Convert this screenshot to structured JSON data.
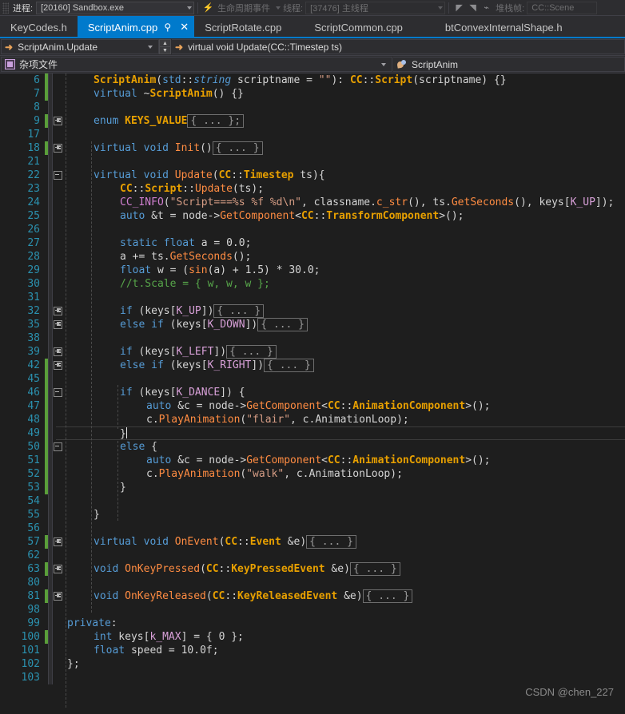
{
  "debug_toolbar": {
    "process_label": "进程:",
    "process_value": "[20160] Sandbox.exe",
    "lifecycle_label": "生命周期事件",
    "thread_label": "线程:",
    "thread_value": "[37476] 主线程",
    "stackframe_label": "堆栈帧:",
    "stackframe_value": "CC::Scene",
    "icons": [
      "grip-icon",
      "chevron-down-icon",
      "step-back-icon",
      "step-forward-icon",
      "diagram-icon"
    ]
  },
  "tabs": [
    {
      "label": "KeyCodes.h",
      "active": false
    },
    {
      "label": "ScriptAnim.cpp",
      "active": true,
      "pin": "pin-icon",
      "close": "close-icon"
    },
    {
      "label": "ScriptRotate.cpp",
      "active": false
    },
    {
      "label": "ScriptCommon.cpp",
      "active": false
    },
    {
      "label": "btConvexInternalShape.h",
      "active": false
    }
  ],
  "navbar": {
    "scope": "ScriptAnim.Update",
    "member": "virtual void Update(CC::Timestep ts)",
    "scope_icon": "arrow-right-icon",
    "member_icon": "arrow-right-icon",
    "spinner_up": "▲",
    "spinner_down": "▼"
  },
  "projectbar": {
    "project": "杂项文件",
    "project_icon": "misc-file-icon",
    "class": "ScriptAnim",
    "class_icon": "class-icon"
  },
  "editor": {
    "language": "cpp",
    "current_line": 49,
    "lines": [
      {
        "num": 6,
        "indent": 1,
        "change": "saved",
        "fold": "none",
        "html": "<span class=\"type\">ScriptAnim</span><span class=\"plain\">(</span><span class=\"kw\">std</span><span class=\"plain\">::</span><span class=\"ital\">string</span><span class=\"plain\"> scriptname = </span><span class=\"str\">\"\"</span><span class=\"plain\">): </span><span class=\"type\">CC</span><span class=\"plain\">::</span><span class=\"type\">Script</span><span class=\"plain\">(scriptname) {}</span>"
      },
      {
        "num": 7,
        "indent": 1,
        "change": "saved",
        "fold": "none",
        "html": "<span class=\"kw\">virtual</span><span class=\"plain\"> ~</span><span class=\"type\">ScriptAnim</span><span class=\"plain\">() {}</span>"
      },
      {
        "num": 8,
        "indent": 1,
        "change": "none",
        "fold": "none",
        "html": ""
      },
      {
        "num": 9,
        "indent": 1,
        "change": "saved",
        "fold": "plus",
        "html": "<span class=\"kw\">enum</span><span class=\"plain\"> </span><span class=\"type\">KEYS_VALUE</span><span class=\"collapsed\">{ ... };</span>"
      },
      {
        "num": 17,
        "indent": 1,
        "change": "none",
        "fold": "none",
        "html": ""
      },
      {
        "num": 18,
        "indent": 1,
        "change": "saved",
        "fold": "plus",
        "html": "<span class=\"kw\">virtual</span><span class=\"plain\"> </span><span class=\"kw\">void</span><span class=\"plain\"> </span><span class=\"fn\">Init</span><span class=\"plain\">()</span><span class=\"collapsed\">{ ... }</span>"
      },
      {
        "num": 21,
        "indent": 1,
        "change": "none",
        "fold": "none",
        "html": ""
      },
      {
        "num": 22,
        "indent": 1,
        "change": "none",
        "fold": "box",
        "html": "<span class=\"kw\">virtual</span><span class=\"plain\"> </span><span class=\"kw\">void</span><span class=\"plain\"> </span><span class=\"fn\">Update</span><span class=\"plain\">(</span><span class=\"type\">CC</span><span class=\"plain\">::</span><span class=\"type\">Timestep</span><span class=\"plain\"> ts){</span>"
      },
      {
        "num": 23,
        "indent": 2,
        "change": "none",
        "fold": "none",
        "html": "<span class=\"type\">CC</span><span class=\"plain\">::</span><span class=\"type\">Script</span><span class=\"plain\">::</span><span class=\"fn\">Update</span><span class=\"plain\">(ts);</span>"
      },
      {
        "num": 24,
        "indent": 2,
        "change": "none",
        "fold": "none",
        "html": "<span class=\"macro\">CC_INFO</span><span class=\"plain\">(</span><span class=\"str\">\"Script===%s %f %d\\n\"</span><span class=\"plain\">, classname.</span><span class=\"fn\">c_str</span><span class=\"plain\">(), ts.</span><span class=\"fn\">GetSeconds</span><span class=\"plain\">(), keys[</span><span class=\"enumv\">K_UP</span><span class=\"plain\">]);</span>"
      },
      {
        "num": 25,
        "indent": 2,
        "change": "none",
        "fold": "none",
        "html": "<span class=\"kw\">auto</span><span class=\"plain\"> &amp;t = node-&gt;</span><span class=\"fn\">GetComponent</span><span class=\"plain\">&lt;</span><span class=\"type\">CC</span><span class=\"plain\">::</span><span class=\"type\">TransformComponent</span><span class=\"plain\">&gt;();</span>"
      },
      {
        "num": 26,
        "indent": 2,
        "change": "none",
        "fold": "none",
        "html": ""
      },
      {
        "num": 27,
        "indent": 2,
        "change": "none",
        "fold": "none",
        "html": "<span class=\"kw\">static</span><span class=\"plain\"> </span><span class=\"kw\">float</span><span class=\"plain\"> a = </span><span class=\"num\">0.0</span><span class=\"plain\">;</span>"
      },
      {
        "num": 28,
        "indent": 2,
        "change": "none",
        "fold": "none",
        "html": "<span class=\"plain\">a += ts.</span><span class=\"fn\">GetSeconds</span><span class=\"plain\">();</span>"
      },
      {
        "num": 29,
        "indent": 2,
        "change": "none",
        "fold": "none",
        "html": "<span class=\"kw\">float</span><span class=\"plain\"> w = (</span><span class=\"fn\">sin</span><span class=\"plain\">(a) + </span><span class=\"num\">1.5</span><span class=\"plain\">) * </span><span class=\"num\">30.0</span><span class=\"plain\">;</span>"
      },
      {
        "num": 30,
        "indent": 2,
        "change": "none",
        "fold": "none",
        "html": "<span class=\"cmt\">//t.Scale = { w, w, w };</span>"
      },
      {
        "num": 31,
        "indent": 2,
        "change": "none",
        "fold": "none",
        "html": ""
      },
      {
        "num": 32,
        "indent": 2,
        "change": "none",
        "fold": "plus",
        "html": "<span class=\"kw\">if</span><span class=\"plain\"> (keys[</span><span class=\"enumv\">K_UP</span><span class=\"plain\">])</span><span class=\"collapsed\">{ ... }</span>"
      },
      {
        "num": 35,
        "indent": 2,
        "change": "none",
        "fold": "plus",
        "html": "<span class=\"kw\">else</span><span class=\"plain\"> </span><span class=\"kw\">if</span><span class=\"plain\"> (keys[</span><span class=\"enumv\">K_DOWN</span><span class=\"plain\">])</span><span class=\"collapsed\">{ ... }</span>"
      },
      {
        "num": 38,
        "indent": 2,
        "change": "none",
        "fold": "none",
        "html": ""
      },
      {
        "num": 39,
        "indent": 2,
        "change": "none",
        "fold": "plus",
        "html": "<span class=\"kw\">if</span><span class=\"plain\"> (keys[</span><span class=\"enumv\">K_LEFT</span><span class=\"plain\">])</span><span class=\"collapsed\">{ ... }</span>"
      },
      {
        "num": 42,
        "indent": 2,
        "change": "saved",
        "fold": "plus",
        "html": "<span class=\"kw\">else</span><span class=\"plain\"> </span><span class=\"kw\">if</span><span class=\"plain\"> (keys[</span><span class=\"enumv\">K_RIGHT</span><span class=\"plain\">])</span><span class=\"collapsed\">{ ... }</span>"
      },
      {
        "num": 45,
        "indent": 2,
        "change": "saved",
        "fold": "none",
        "html": ""
      },
      {
        "num": 46,
        "indent": 2,
        "change": "saved",
        "fold": "box",
        "html": "<span class=\"kw\">if</span><span class=\"plain\"> (keys[</span><span class=\"enumv\">K_DANCE</span><span class=\"plain\">]) {</span>"
      },
      {
        "num": 47,
        "indent": 3,
        "change": "saved",
        "fold": "none",
        "html": "<span class=\"kw\">auto</span><span class=\"plain\"> &amp;c = node-&gt;</span><span class=\"fn\">GetComponent</span><span class=\"plain\">&lt;</span><span class=\"type\">CC</span><span class=\"plain\">::</span><span class=\"type\">AnimationComponent</span><span class=\"plain\">&gt;();</span>"
      },
      {
        "num": 48,
        "indent": 3,
        "change": "saved",
        "fold": "none",
        "html": "<span class=\"plain\">c.</span><span class=\"fn\">PlayAnimation</span><span class=\"plain\">(</span><span class=\"str\">\"flair\"</span><span class=\"plain\">, c.AnimationLoop);</span>"
      },
      {
        "num": 49,
        "indent": 2,
        "change": "saved",
        "fold": "none",
        "current": true,
        "html": "<span class=\"plain\">}</span><span class=\"caret-bar\"></span>"
      },
      {
        "num": 50,
        "indent": 2,
        "change": "saved",
        "fold": "box",
        "html": "<span class=\"kw\">else</span><span class=\"plain\"> {</span>"
      },
      {
        "num": 51,
        "indent": 3,
        "change": "saved",
        "fold": "none",
        "html": "<span class=\"kw\">auto</span><span class=\"plain\"> &amp;c = node-&gt;</span><span class=\"fn\">GetComponent</span><span class=\"plain\">&lt;</span><span class=\"type\">CC</span><span class=\"plain\">::</span><span class=\"type\">AnimationComponent</span><span class=\"plain\">&gt;();</span>"
      },
      {
        "num": 52,
        "indent": 3,
        "change": "saved",
        "fold": "none",
        "html": "<span class=\"plain\">c.</span><span class=\"fn\">PlayAnimation</span><span class=\"plain\">(</span><span class=\"str\">\"walk\"</span><span class=\"plain\">, c.AnimationLoop);</span>"
      },
      {
        "num": 53,
        "indent": 2,
        "change": "saved",
        "fold": "none",
        "html": "<span class=\"plain\">}</span>"
      },
      {
        "num": 54,
        "indent": 2,
        "change": "none",
        "fold": "none",
        "html": ""
      },
      {
        "num": 55,
        "indent": 1,
        "change": "none",
        "fold": "none",
        "html": "<span class=\"plain\">}</span>"
      },
      {
        "num": 56,
        "indent": 1,
        "change": "none",
        "fold": "none",
        "html": ""
      },
      {
        "num": 57,
        "indent": 1,
        "change": "saved",
        "fold": "plus",
        "html": "<span class=\"kw\">virtual</span><span class=\"plain\"> </span><span class=\"kw\">void</span><span class=\"plain\"> </span><span class=\"fn\">OnEvent</span><span class=\"plain\">(</span><span class=\"type\">CC</span><span class=\"plain\">::</span><span class=\"type\">Event</span><span class=\"plain\"> &amp;e)</span><span class=\"collapsed\">{ ... }</span>"
      },
      {
        "num": 62,
        "indent": 1,
        "change": "none",
        "fold": "none",
        "html": ""
      },
      {
        "num": 63,
        "indent": 1,
        "change": "saved",
        "fold": "plus",
        "html": "<span class=\"kw\">void</span><span class=\"plain\"> </span><span class=\"fn\">OnKeyPressed</span><span class=\"plain\">(</span><span class=\"type\">CC</span><span class=\"plain\">::</span><span class=\"type\">KeyPressedEvent</span><span class=\"plain\"> &amp;e)</span><span class=\"collapsed\">{ ... }</span>"
      },
      {
        "num": 80,
        "indent": 1,
        "change": "none",
        "fold": "none",
        "html": ""
      },
      {
        "num": 81,
        "indent": 1,
        "change": "saved",
        "fold": "plus",
        "html": "<span class=\"kw\">void</span><span class=\"plain\"> </span><span class=\"fn\">OnKeyReleased</span><span class=\"plain\">(</span><span class=\"type\">CC</span><span class=\"plain\">::</span><span class=\"type\">KeyReleasedEvent</span><span class=\"plain\"> &amp;e)</span><span class=\"collapsed\">{ ... }</span>"
      },
      {
        "num": 98,
        "indent": 1,
        "change": "none",
        "fold": "none",
        "html": ""
      },
      {
        "num": 99,
        "indent": 0,
        "change": "none",
        "fold": "none",
        "html": "<span class=\"kw\">private</span><span class=\"plain\">:</span>"
      },
      {
        "num": 100,
        "indent": 1,
        "change": "saved",
        "fold": "none",
        "html": "<span class=\"kw\">int</span><span class=\"plain\"> keys[</span><span class=\"enumv\">k_MAX</span><span class=\"plain\">] = { </span><span class=\"num\">0</span><span class=\"plain\"> };</span>"
      },
      {
        "num": 101,
        "indent": 1,
        "change": "none",
        "fold": "none",
        "html": "<span class=\"kw\">float</span><span class=\"plain\"> speed = </span><span class=\"num\">10.0f</span><span class=\"plain\">;</span>"
      },
      {
        "num": 102,
        "indent": 0,
        "change": "none",
        "fold": "none",
        "html": "<span class=\"plain\">};</span>"
      },
      {
        "num": 103,
        "indent": 0,
        "change": "none",
        "fold": "none",
        "html": ""
      }
    ]
  },
  "watermark": "CSDN @chen_227",
  "colors": {
    "accent": "#007acc",
    "editor_bg": "#1e1e1e",
    "chrome_bg": "#2d2d30",
    "line_number": "#2b91af",
    "keyword": "#569cd6",
    "type": "#e8a000",
    "function": "#ff8c42",
    "string": "#d69d85",
    "comment": "#57a64a",
    "macro": "#d07fd0",
    "change_saved": "#5a9e3a"
  }
}
